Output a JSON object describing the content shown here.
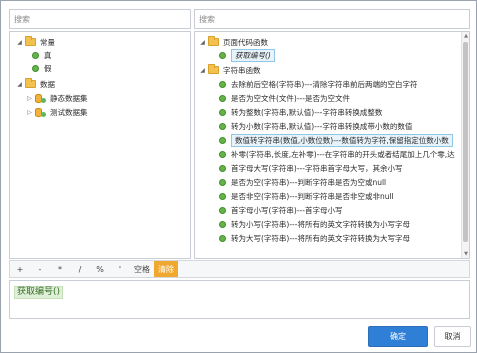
{
  "left_search": {
    "placeholder": "搜索"
  },
  "right_search": {
    "placeholder": "搜索"
  },
  "left_tree": {
    "constants_label": "常量",
    "constants_items": [
      "真",
      "假"
    ],
    "data_label": "数据",
    "data_items": [
      "静态数据集",
      "测试数据集"
    ]
  },
  "right_tree": {
    "page_code_group": "页面代码函数",
    "page_code_items": [
      "获取编号()"
    ],
    "string_group": "字符串函数",
    "string_items": [
      "去除前后空格(字符串)---清除字符串前后两端的空白字符",
      "是否为空文件(文件)---是否为空文件",
      "转为整数(字符串,默认值)---字符串转换成整数",
      "转为小数(字符串,默认值)---字符串转换成带小数的数值",
      "数值转字符串(数值,小数位数)---数值转为字符,保留指定位数小数",
      "补零(字符串,长度,左补零)---在字符串的开头或者结尾加上几个零,达",
      "首字母大写(字符串)---字符串首字母大写，其余小写",
      "是否为空(字符串)---判断字符串是否为空或null",
      "是否非空(字符串)---判断字符串是否非空或非null",
      "首字母小写(字符串)---首字母小写",
      "转为小写(字符串)---将所有的英文字符转换为小写字母",
      "转为大写(字符串)---将所有的英文字符转换为大写字母"
    ]
  },
  "toolbar": {
    "ops": [
      "+",
      "-",
      "*",
      "/",
      "%",
      "'",
      "空格"
    ],
    "clear_label": "清除"
  },
  "expression": {
    "text": "获取编号()"
  },
  "buttons": {
    "ok": "确定",
    "cancel": "取消"
  },
  "colors": {
    "accent": "#2f7fd6",
    "clear": "#f0a830",
    "expr_bg": "#dff0d8",
    "node_dot": "#67b34a"
  }
}
